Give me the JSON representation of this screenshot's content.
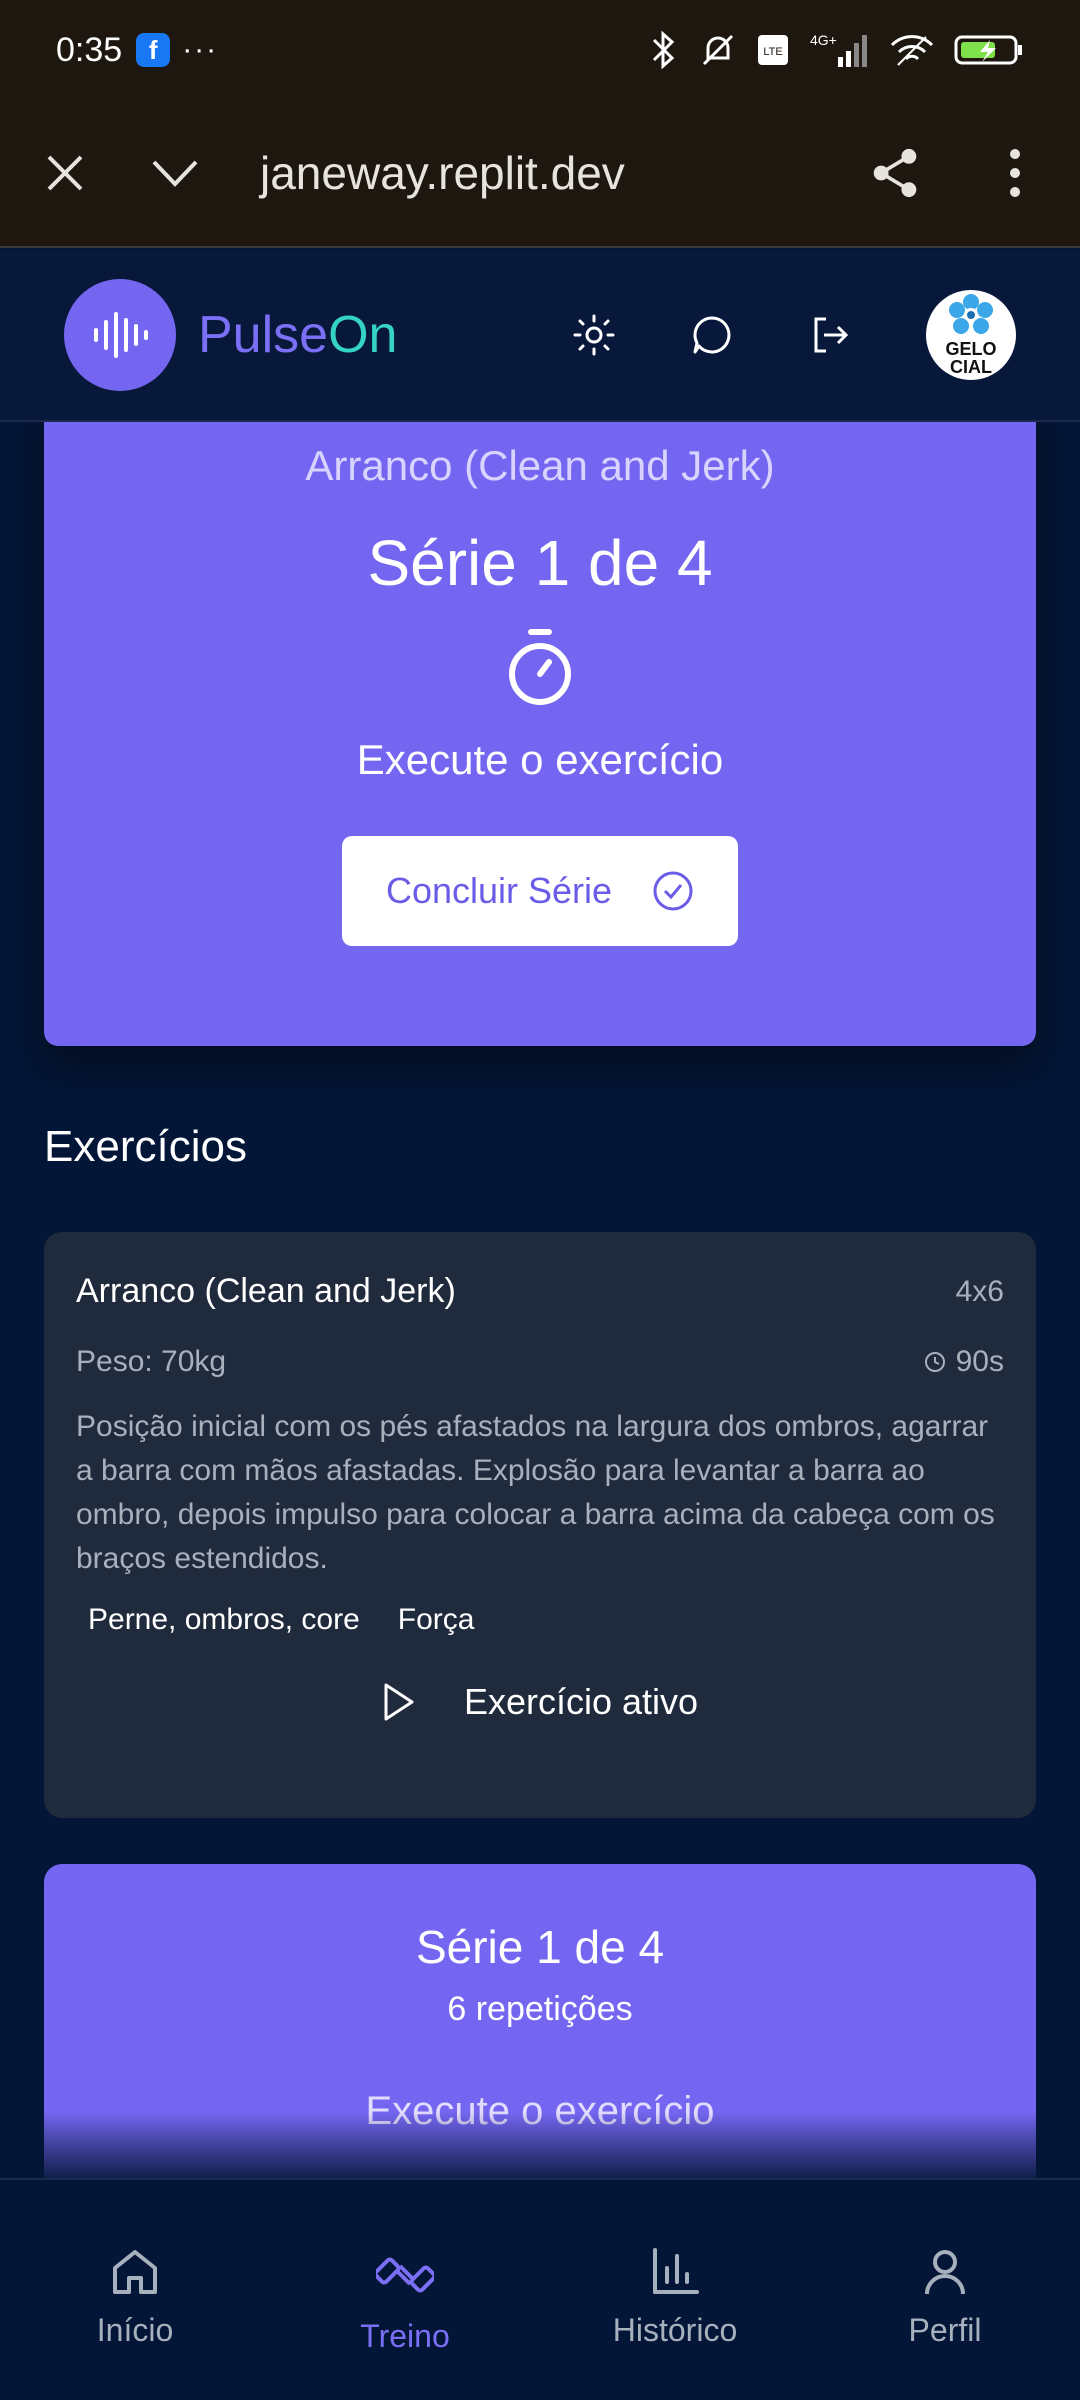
{
  "status_bar": {
    "time": "0:35",
    "app_badge": "f",
    "more": "···"
  },
  "browser": {
    "url": "janeway.replit.dev"
  },
  "header": {
    "brand_part1": "Pulse",
    "brand_part2": "On",
    "avatar_text_1": "GELO",
    "avatar_text_2": "CIAL"
  },
  "current_series": {
    "exercise_name": "Arranco (Clean and Jerk)",
    "series_title": "Série 1 de 4",
    "instruction": "Execute o exercício",
    "finish_button": "Concluir Série"
  },
  "exercises_section": {
    "title": "Exercícios"
  },
  "exercise": {
    "name": "Arranco (Clean and Jerk)",
    "sets": "4x6",
    "weight": "Peso: 70kg",
    "rest": "90s",
    "description": "Posição inicial com os pés afastados na largura dos ombros, agarrar a barra com mãos afastadas. Explosão para levantar a barra ao ombro, depois impulso para colocar a barra acima da cabeça com os braços estendidos.",
    "tags": [
      "Perne, ombros, core",
      "Força"
    ],
    "active_label": "Exercício ativo"
  },
  "series_card_2": {
    "title": "Série 1 de 4",
    "reps": "6 repetições",
    "instruction": "Execute o exercício"
  },
  "bottom_nav": {
    "items": [
      {
        "label": "Início",
        "icon": "home-icon"
      },
      {
        "label": "Treino",
        "icon": "dumbbell-icon",
        "active": true
      },
      {
        "label": "Histórico",
        "icon": "bar-chart-icon"
      },
      {
        "label": "Perfil",
        "icon": "user-icon"
      }
    ]
  },
  "colors": {
    "accent": "#7466f0",
    "brand_teal": "#34d3c4",
    "background": "#041637",
    "card": "#1f2a3c"
  }
}
